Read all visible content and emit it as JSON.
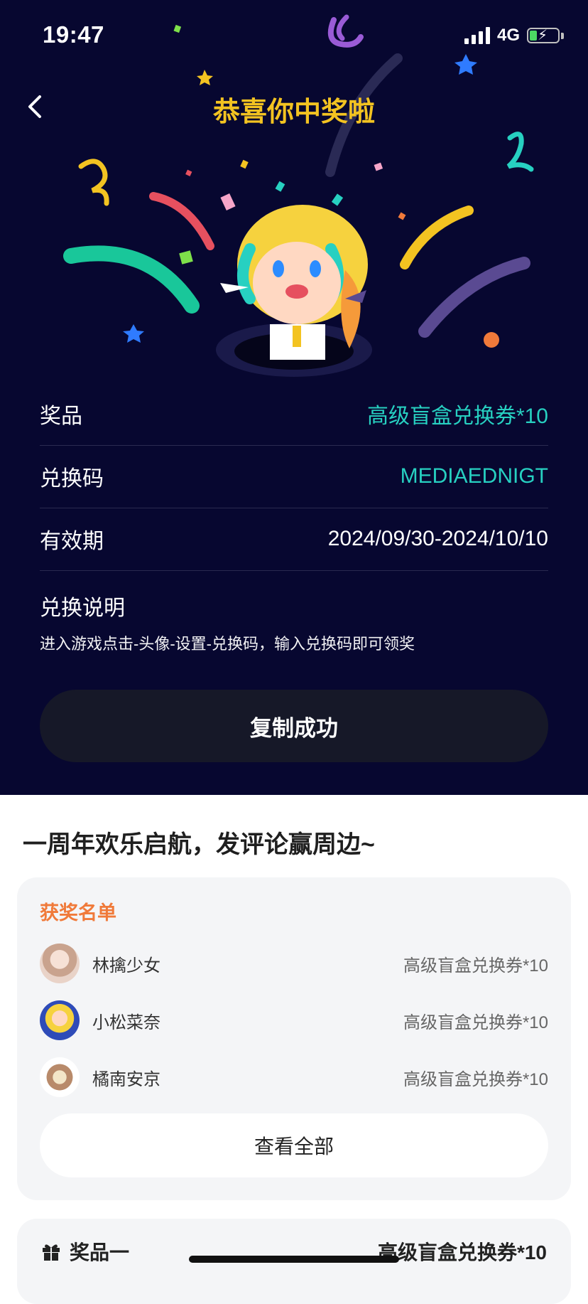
{
  "status_bar": {
    "time": "19:47",
    "network": "4G"
  },
  "header": {
    "title": "恭喜你中奖啦"
  },
  "prize_info": {
    "rows": [
      {
        "label": "奖品",
        "value": "高级盲盒兑换券*10"
      },
      {
        "label": "兑换码",
        "value": "MEDIAEDNIGT"
      },
      {
        "label": "有效期",
        "value": "2024/09/30-2024/10/10"
      }
    ],
    "instructions_title": "兑换说明",
    "instructions_text": "进入游戏点击-头像-设置-兑换码，输入兑换码即可领奖",
    "copy_button": "复制成功"
  },
  "event": {
    "title": "一周年欢乐启航，发评论赢周边~",
    "winners_title": "获奖名单",
    "winners": [
      {
        "name": "林擒少女",
        "prize": "高级盲盒兑换券*10"
      },
      {
        "name": "小松菜奈",
        "prize": "高级盲盒兑换券*10"
      },
      {
        "name": "橘南安京",
        "prize": "高级盲盒兑换券*10"
      }
    ],
    "view_all": "查看全部"
  },
  "prize_list": [
    {
      "label": "奖品一",
      "value": "高级盲盒兑换券*10"
    }
  ],
  "colors": {
    "hero_bg": "#070730",
    "title_gold": "#f3c321",
    "teal": "#27d0c1",
    "orange": "#f07a3a"
  }
}
